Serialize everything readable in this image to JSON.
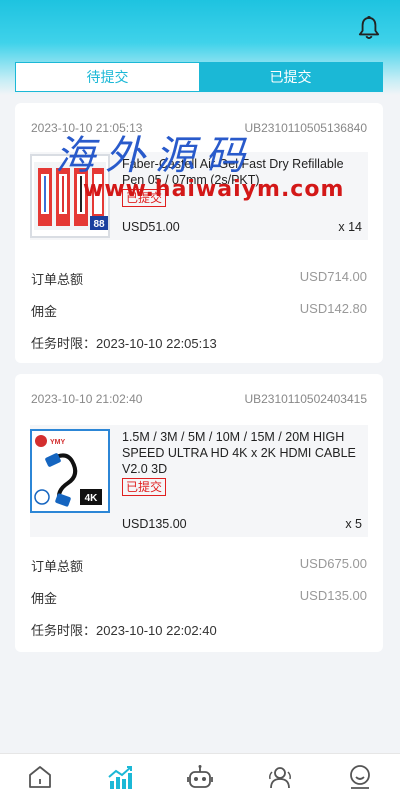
{
  "tabs": [
    {
      "label": "待提交",
      "active": false
    },
    {
      "label": "已提交",
      "active": true
    }
  ],
  "orders": [
    {
      "datetime": "2023-10-10 21:05:13",
      "order_id": "UB2310110505136840",
      "product_name": "Faber-Castell Air Gel Fast Dry Refillable Pen 05 / 07mm (2s/PKT)",
      "status": "已提交",
      "price": "USD51.00",
      "qty": "x 14",
      "total_label": "订单总额",
      "total_value": "USD714.00",
      "commission_label": "佣金",
      "commission_value": "USD142.80",
      "deadline": "任务时限：2023-10-10 22:05:13"
    },
    {
      "datetime": "2023-10-10 21:02:40",
      "order_id": "UB2310110502403415",
      "product_name": "1.5M / 3M / 5M / 10M / 15M / 20M HIGH SPEED ULTRA HD 4K x 2K HDMI CABLE V2.0 3D",
      "status": "已提交",
      "price": "USD135.00",
      "qty": "x 5",
      "total_label": "订单总额",
      "total_value": "USD675.00",
      "commission_label": "佣金",
      "commission_value": "USD135.00",
      "deadline": "任务时限：2023-10-10 22:02:40"
    }
  ],
  "thumb2": {
    "brand": "YMY",
    "badge": "4K"
  },
  "thumb1": {
    "badge": "88"
  },
  "watermark": {
    "text": "海外源码",
    "url": "www.haiwaiym.com"
  },
  "icons": {
    "header": "bell-icon",
    "nav": [
      "home-icon",
      "chart-icon",
      "robot-icon",
      "users-icon",
      "profile-icon"
    ]
  },
  "colors": {
    "accent": "#1bb8d6",
    "status": "#e02020"
  }
}
